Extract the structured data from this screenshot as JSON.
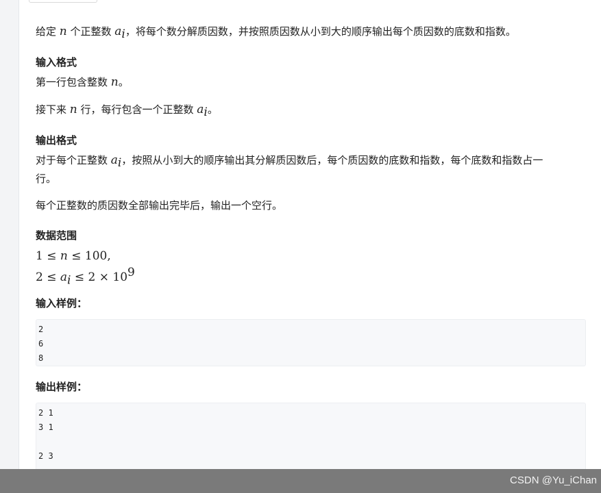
{
  "problem": {
    "intro_a": "给定 ",
    "intro_n": "n",
    "intro_b": " 个正整数 ",
    "intro_ai": "a",
    "intro_sub": "i",
    "intro_c": "，将每个数分解质因数，并按照质因数从小到大的顺序输出每个质因数的底数和指数。"
  },
  "input_format": {
    "heading": "输入格式",
    "line1_a": "第一行包含整数 ",
    "line1_n": "n",
    "line1_b": "。",
    "line2_a": "接下来 ",
    "line2_n": "n",
    "line2_b": " 行，每行包含一个正整数 ",
    "line2_ai": "a",
    "line2_sub": "i",
    "line2_c": "。"
  },
  "output_format": {
    "heading": "输出格式",
    "line1_a": "对于每个正整数 ",
    "line1_ai": "a",
    "line1_sub": "i",
    "line1_b": "，按照从小到大的顺序输出其分解质因数后，每个质因数的底数和指数，每个底数和指数占一",
    "line1_wrap": "行。",
    "line2": "每个正整数的质因数全部输出完毕后，输出一个空行。"
  },
  "range": {
    "heading": "数据范围",
    "r1_a": "1 ≤ ",
    "r1_n": "n",
    "r1_b": " ≤ 100,",
    "r2_a": "2 ≤ ",
    "r2_ai": "a",
    "r2_sub": "i",
    "r2_b": " ≤ 2 × 10",
    "r2_sup": "9"
  },
  "sample_input": {
    "heading": "输入样例：",
    "lines": [
      "2",
      "6",
      "8"
    ]
  },
  "sample_output": {
    "heading": "输出样例：",
    "lines": [
      "2 1",
      "3 1",
      "",
      "2 3"
    ]
  },
  "footer": {
    "watermark": "CSDN @Yu_iChan"
  }
}
